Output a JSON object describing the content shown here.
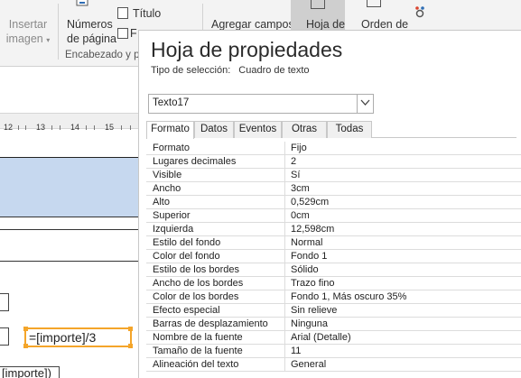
{
  "ribbon": {
    "insert_image": {
      "line1": "Insertar",
      "line2": "imagen",
      "arrow": "▾"
    },
    "page_numbers": {
      "line1": "Números",
      "line2": "de página"
    },
    "title_label": "Título",
    "fecha_label": "F",
    "group_label": "Encabezado y p",
    "add_fields": "Agregar campos",
    "property_sheet": "Hoja de",
    "tab_order": "Orden de"
  },
  "ruler": {
    "labels": [
      "12",
      "13",
      "14",
      "15"
    ]
  },
  "design": {
    "expression": "=[importe]/3",
    "bottom_field": "[importe])"
  },
  "property_sheet": {
    "title": "Hoja de propiedades",
    "selection_type_label": "Tipo de selección:",
    "selection_type_value": "Cuadro de texto",
    "object_combo": "Texto17",
    "tabs": [
      "Formato",
      "Datos",
      "Eventos",
      "Otras",
      "Todas"
    ],
    "rows": [
      {
        "prop": "Formato",
        "value": "Fijo"
      },
      {
        "prop": "Lugares decimales",
        "value": "2"
      },
      {
        "prop": "Visible",
        "value": "Sí"
      },
      {
        "prop": "Ancho",
        "value": "3cm"
      },
      {
        "prop": "Alto",
        "value": "0,529cm"
      },
      {
        "prop": "Superior",
        "value": "0cm"
      },
      {
        "prop": "Izquierda",
        "value": "12,598cm"
      },
      {
        "prop": "Estilo del fondo",
        "value": "Normal"
      },
      {
        "prop": "Color del fondo",
        "value": "Fondo 1"
      },
      {
        "prop": "Estilo de los bordes",
        "value": "Sólido"
      },
      {
        "prop": "Ancho de los bordes",
        "value": "Trazo fino"
      },
      {
        "prop": "Color de los bordes",
        "value": "Fondo 1, Más oscuro 35%"
      },
      {
        "prop": "Efecto especial",
        "value": "Sin relieve"
      },
      {
        "prop": "Barras de desplazamiento",
        "value": "Ninguna"
      },
      {
        "prop": "Nombre de la fuente",
        "value": "Arial (Detalle)"
      },
      {
        "prop": "Tamaño de la fuente",
        "value": "11"
      },
      {
        "prop": "Alineación del texto",
        "value": "General"
      }
    ]
  },
  "colors": {
    "selection_accent": "#f4a52a",
    "section_highlight": "#c6d8ef"
  }
}
